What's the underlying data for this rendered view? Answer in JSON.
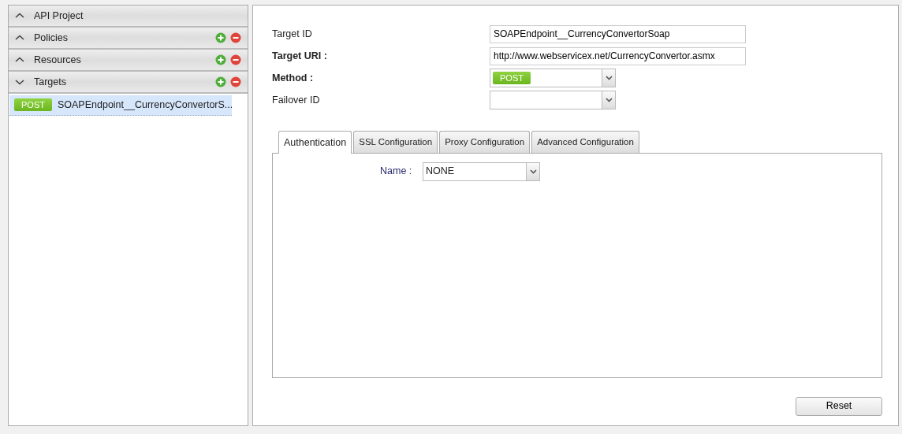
{
  "sidebar": {
    "sections": [
      {
        "title": "API Project",
        "kind": "project",
        "expanded": false
      },
      {
        "title": "Policies",
        "kind": "group",
        "expanded": false
      },
      {
        "title": "Resources",
        "kind": "group",
        "expanded": false
      },
      {
        "title": "Targets",
        "kind": "group",
        "expanded": true,
        "items": [
          {
            "method": "POST",
            "label": "SOAPEndpoint__CurrencyConvertorS...",
            "selected": true
          }
        ]
      }
    ]
  },
  "form": {
    "fields": [
      {
        "label": "Target ID",
        "bold": false,
        "kind": "text",
        "value": "SOAPEndpoint__CurrencyConvertorSoap"
      },
      {
        "label": "Target URI :",
        "bold": true,
        "kind": "text",
        "value": "http://www.webservicex.net/CurrencyConvertor.asmx"
      },
      {
        "label": "Method :",
        "bold": true,
        "kind": "method",
        "value": "POST"
      },
      {
        "label": "Failover ID",
        "bold": false,
        "kind": "select"
      }
    ]
  },
  "tabs": [
    {
      "label": "Authentication",
      "selected": true
    },
    {
      "label": "SSL Configuration",
      "selected": false
    },
    {
      "label": "Proxy Configuration",
      "selected": false
    },
    {
      "label": "Advanced Configuration",
      "selected": false
    }
  ],
  "auth": {
    "label": "Name :",
    "value": "NONE"
  },
  "buttons": [
    "Reset"
  ]
}
